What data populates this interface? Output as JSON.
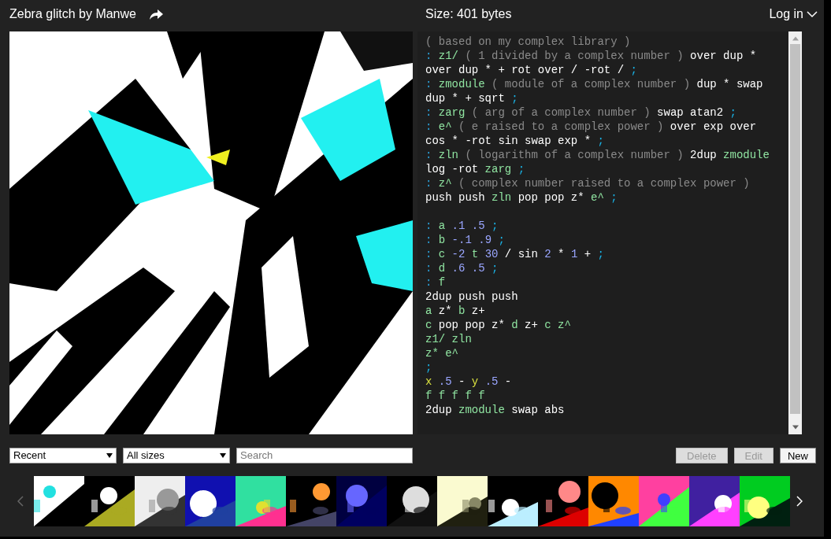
{
  "header": {
    "title": "Zebra glitch by Manwe",
    "size": "Size: 401 bytes",
    "login": "Log in"
  },
  "code_lines": [
    [
      {
        "kind": "comment",
        "text": "( based on my complex library )"
      }
    ],
    [
      {
        "kind": "colon",
        "text": ":"
      },
      {
        "kind": "name",
        "text": "z1/"
      },
      {
        "kind": "comment",
        "text": "( 1 divided by a complex number )"
      },
      {
        "kind": "word",
        "text": "over dup *"
      }
    ],
    [
      {
        "kind": "word",
        "text": "over dup * + rot over / -rot /"
      },
      {
        "kind": "semi",
        "text": ";"
      }
    ],
    [
      {
        "kind": "colon",
        "text": ":"
      },
      {
        "kind": "name",
        "text": "zmodule"
      },
      {
        "kind": "comment",
        "text": "( module of a complex number )"
      },
      {
        "kind": "word",
        "text": "dup * swap"
      }
    ],
    [
      {
        "kind": "word",
        "text": "dup * + sqrt"
      },
      {
        "kind": "semi",
        "text": ";"
      }
    ],
    [
      {
        "kind": "colon",
        "text": ":"
      },
      {
        "kind": "name",
        "text": "zarg"
      },
      {
        "kind": "comment",
        "text": "( arg of a complex number )"
      },
      {
        "kind": "word",
        "text": "swap atan2"
      },
      {
        "kind": "semi",
        "text": ";"
      }
    ],
    [
      {
        "kind": "colon",
        "text": ":"
      },
      {
        "kind": "name",
        "text": "e^"
      },
      {
        "kind": "comment",
        "text": "( e raised to a complex power )"
      },
      {
        "kind": "word",
        "text": "over exp over"
      }
    ],
    [
      {
        "kind": "word",
        "text": "cos * -rot sin swap exp *"
      },
      {
        "kind": "semi",
        "text": ";"
      }
    ],
    [
      {
        "kind": "colon",
        "text": ":"
      },
      {
        "kind": "name",
        "text": "zln"
      },
      {
        "kind": "comment",
        "text": "( logarithm of a complex number )"
      },
      {
        "kind": "word",
        "text": "2dup"
      },
      {
        "kind": "name",
        "text": "zmodule"
      }
    ],
    [
      {
        "kind": "word",
        "text": "log -rot"
      },
      {
        "kind": "name",
        "text": "zarg"
      },
      {
        "kind": "semi",
        "text": ";"
      }
    ],
    [
      {
        "kind": "colon",
        "text": ":"
      },
      {
        "kind": "name",
        "text": "z^"
      },
      {
        "kind": "comment",
        "text": "( complex number raised to a complex power )"
      }
    ],
    [
      {
        "kind": "word",
        "text": "push push"
      },
      {
        "kind": "name",
        "text": "zln"
      },
      {
        "kind": "word",
        "text": "pop pop z*"
      },
      {
        "kind": "name",
        "text": "e^"
      },
      {
        "kind": "semi",
        "text": ";"
      }
    ],
    [
      {
        "kind": "colon",
        "text": ":",
        "space_before": true
      },
      {
        "kind": "name",
        "text": "a"
      },
      {
        "kind": "number",
        "text": ".1 .5"
      },
      {
        "kind": "semi",
        "text": ";"
      }
    ],
    [
      {
        "kind": "colon",
        "text": ":"
      },
      {
        "kind": "name",
        "text": "b"
      },
      {
        "kind": "number",
        "text": "-.1 .9"
      },
      {
        "kind": "semi",
        "text": ";"
      }
    ],
    [
      {
        "kind": "colon",
        "text": ":"
      },
      {
        "kind": "name",
        "text": "c"
      },
      {
        "kind": "number",
        "text": "-2"
      },
      {
        "kind": "name",
        "text": "t"
      },
      {
        "kind": "number",
        "text": "30"
      },
      {
        "kind": "word",
        "text": "/ sin"
      },
      {
        "kind": "number",
        "text": "2"
      },
      {
        "kind": "word",
        "text": "*"
      },
      {
        "kind": "number",
        "text": "1"
      },
      {
        "kind": "word",
        "text": "+"
      },
      {
        "kind": "semi",
        "text": ";"
      }
    ],
    [
      {
        "kind": "colon",
        "text": ":"
      },
      {
        "kind": "name",
        "text": "d"
      },
      {
        "kind": "number",
        "text": ".6 .5"
      },
      {
        "kind": "semi",
        "text": ";"
      }
    ],
    [
      {
        "kind": "colon",
        "text": ":"
      },
      {
        "kind": "name",
        "text": "f"
      }
    ],
    [
      {
        "kind": "word",
        "text": "2dup push push"
      }
    ],
    [
      {
        "kind": "name",
        "text": "a"
      },
      {
        "kind": "word",
        "text": "z*"
      },
      {
        "kind": "name",
        "text": "b"
      },
      {
        "kind": "word",
        "text": "z+"
      }
    ],
    [
      {
        "kind": "name",
        "text": "c"
      },
      {
        "kind": "word",
        "text": "pop pop z*"
      },
      {
        "kind": "name",
        "text": "d"
      },
      {
        "kind": "word",
        "text": "z+"
      },
      {
        "kind": "name",
        "text": "c z^"
      }
    ],
    [
      {
        "kind": "name",
        "text": "z1/ zln"
      }
    ],
    [
      {
        "kind": "name",
        "text": "z* e^"
      }
    ],
    [
      {
        "kind": "semi",
        "text": ";"
      }
    ],
    [
      {
        "kind": "var",
        "text": "x"
      },
      {
        "kind": "number",
        "text": ".5"
      },
      {
        "kind": "word",
        "text": "-"
      },
      {
        "kind": "var",
        "text": "y"
      },
      {
        "kind": "number",
        "text": ".5"
      },
      {
        "kind": "word",
        "text": "-"
      }
    ],
    [
      {
        "kind": "name",
        "text": "f f f f f"
      }
    ],
    [
      {
        "kind": "word",
        "text": "2dup"
      },
      {
        "kind": "name",
        "text": "zmodule"
      },
      {
        "kind": "word",
        "text": "swap abs"
      }
    ]
  ],
  "filters": [
    {
      "value": "Recent"
    },
    {
      "value": "All sizes"
    }
  ],
  "search": {
    "placeholder": "Search"
  },
  "buttons": [
    {
      "label": "Delete",
      "disabled": true
    },
    {
      "label": "Edit",
      "disabled": true
    },
    {
      "label": "New",
      "disabled": false
    }
  ],
  "thumbnails": [
    {
      "kind": "picture"
    },
    {
      "kind": "picture"
    },
    {
      "kind": "picture"
    },
    {
      "kind": "picture"
    },
    {
      "kind": "picture"
    },
    {
      "kind": "picture"
    },
    {
      "kind": "picture"
    },
    {
      "kind": "picture"
    },
    {
      "kind": "picture"
    },
    {
      "kind": "picture"
    },
    {
      "kind": "picture"
    },
    {
      "kind": "picture"
    },
    {
      "kind": "picture"
    },
    {
      "kind": "picture"
    },
    {
      "kind": "picture"
    }
  ]
}
